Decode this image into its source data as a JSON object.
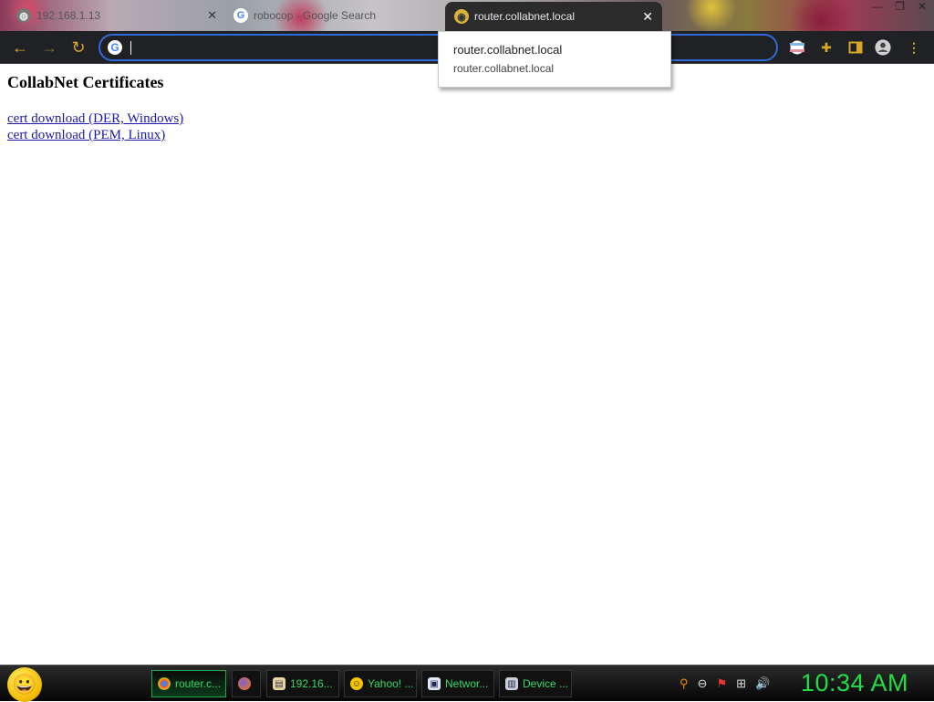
{
  "browser": {
    "tabs": [
      {
        "title": "192.168.1.13",
        "favicon": "globe-icon",
        "active": false
      },
      {
        "title": "robocop - Google Search",
        "favicon": "google-icon",
        "active": false
      },
      {
        "title": "router.collabnet.local",
        "favicon": "page-icon",
        "active": true
      }
    ],
    "window_controls": [
      "minimize-icon",
      "restore-icon",
      "close-icon"
    ],
    "omnibox": {
      "value": "",
      "icon": "google-icon"
    },
    "suggestion": {
      "primary": "router.collabnet.local",
      "secondary": "router.collabnet.local"
    },
    "accent": "#2f6ad9"
  },
  "page": {
    "title": "CollabNet Certificates",
    "links": [
      "cert download (DER, Windows)",
      "cert download (PEM, Linux)"
    ]
  },
  "taskbar": {
    "tasks": [
      {
        "label": "router.c...",
        "icon": "chrome-icon",
        "active": true
      },
      {
        "label": "",
        "icon": "firefox-icon",
        "active": false
      },
      {
        "label": "192.16...",
        "icon": "document-icon",
        "active": false
      },
      {
        "label": "Yahoo! ...",
        "icon": "yahoo-messenger-icon",
        "active": false
      },
      {
        "label": "Networ...",
        "icon": "network-icon",
        "active": false
      },
      {
        "label": "Device ...",
        "icon": "device-icon",
        "active": false
      }
    ],
    "clock": "10:34 AM",
    "clock_color": "#22dd44"
  }
}
